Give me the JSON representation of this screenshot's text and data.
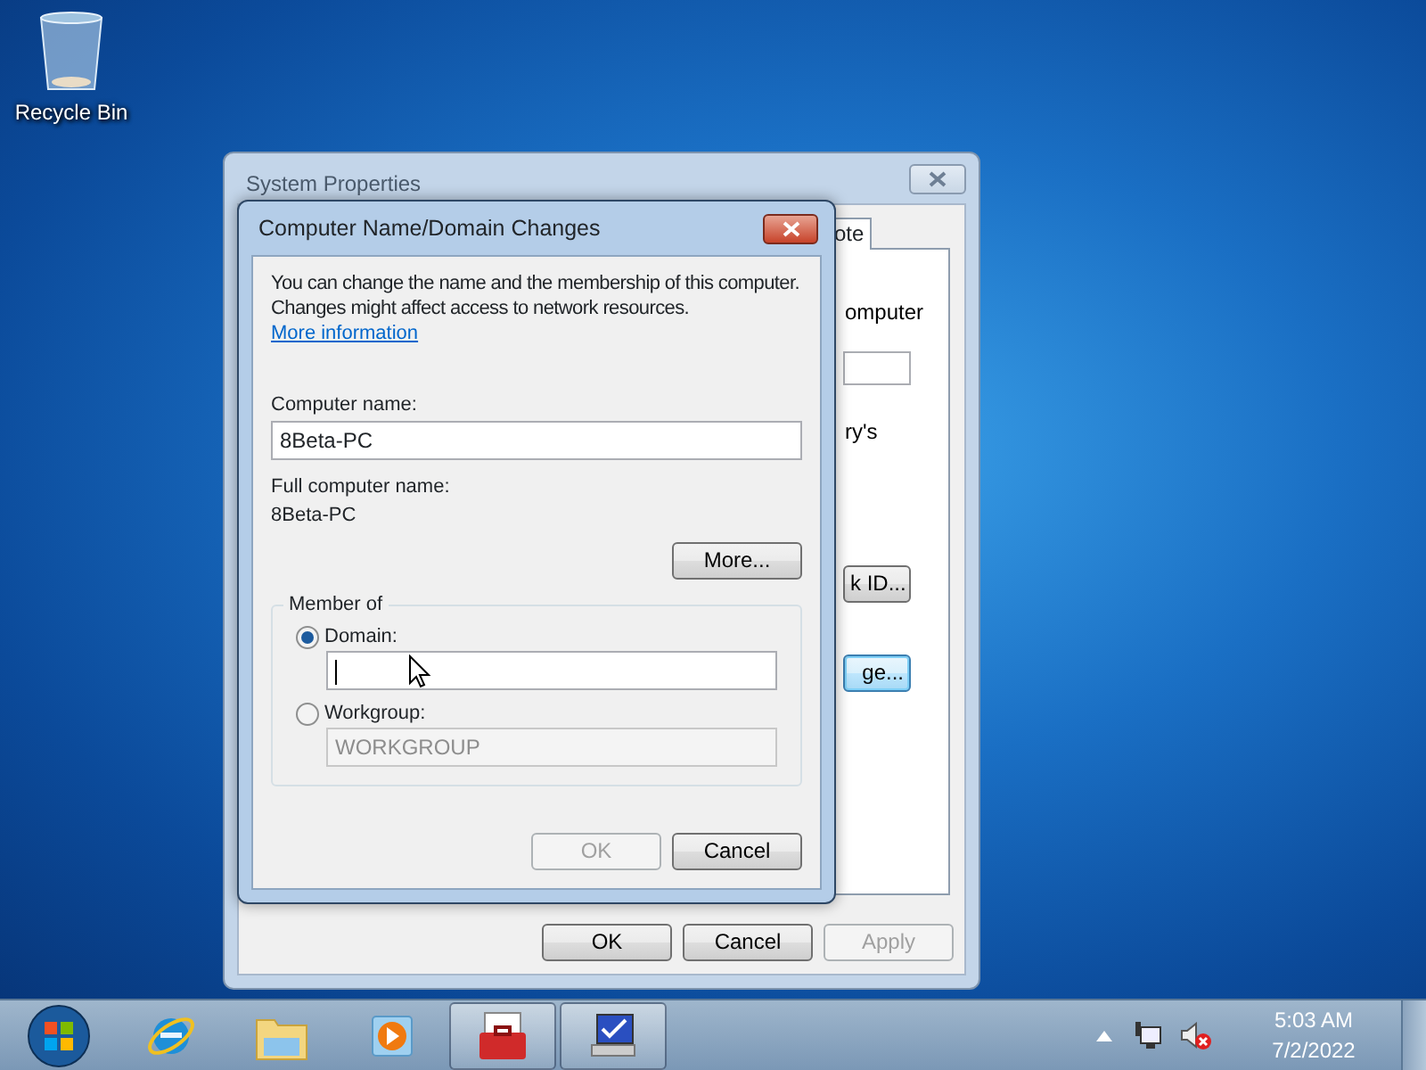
{
  "desktop": {
    "icons": [
      {
        "label": "Recycle Bin"
      }
    ]
  },
  "back_window": {
    "title": "System Properties",
    "tabs": [
      {
        "label": "ote",
        "selected": true
      }
    ],
    "texts": [
      "omputer",
      "ry's"
    ],
    "buttons": [
      {
        "label": "k ID...",
        "default": false
      },
      {
        "label": "ge...",
        "default": true
      }
    ],
    "footer_buttons": [
      {
        "label": "OK",
        "disabled": false
      },
      {
        "label": "Cancel",
        "disabled": false
      },
      {
        "label": "Apply",
        "disabled": true
      }
    ]
  },
  "dialog": {
    "title": "Computer Name/Domain Changes",
    "intro": "You can change the name and the membership of this computer. Changes might affect access to network resources.",
    "link": "More information",
    "computer_name_label": "Computer name:",
    "computer_name": "8Beta-PC",
    "full_name_label": "Full computer name:",
    "full_name": "8Beta-PC",
    "more_button": "More...",
    "member_of": {
      "legend": "Member of",
      "options": [
        {
          "label": "Domain:",
          "selected": true,
          "disabled": false
        },
        {
          "label": "Workgroup:",
          "selected": false,
          "value": "WORKGROUP",
          "disabled": true
        }
      ]
    },
    "buttons": [
      {
        "label": "OK",
        "disabled": true
      },
      {
        "label": "Cancel",
        "disabled": false
      }
    ]
  },
  "taskbar": {
    "items": [
      {
        "kind": "start",
        "active": false
      },
      {
        "kind": "browser",
        "active": false
      },
      {
        "kind": "folder",
        "active": false
      },
      {
        "kind": "media",
        "active": false
      },
      {
        "kind": "toolbox",
        "active": true
      },
      {
        "kind": "monitor",
        "active": true
      }
    ],
    "tray": {
      "volume_muted": true,
      "time": "5:03 AM",
      "date": "7/2/2022"
    }
  }
}
